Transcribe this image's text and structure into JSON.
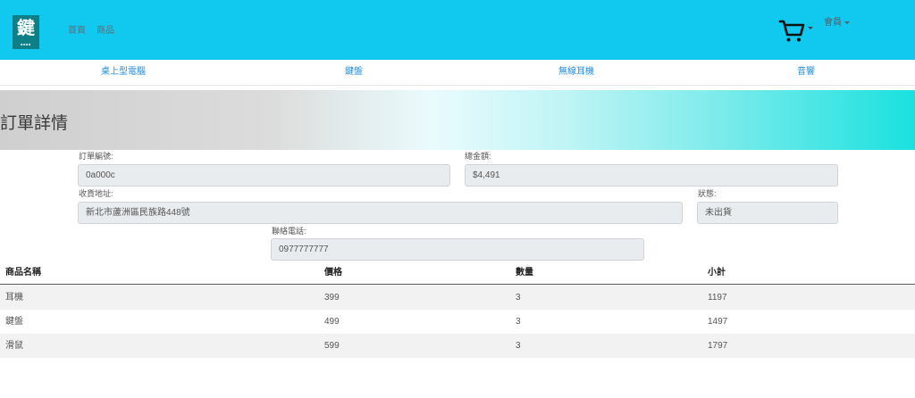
{
  "brand": {
    "logo_char": "鍵",
    "logo_sub": "■■■■"
  },
  "nav": {
    "home": "首頁",
    "products": "商品"
  },
  "member_menu": {
    "label": "會員"
  },
  "categories": [
    "桌上型電腦",
    "鍵盤",
    "無線耳機",
    "音響"
  ],
  "page": {
    "title": "訂單詳情"
  },
  "order": {
    "order_no_label": "訂單編號:",
    "order_no": "0a000c",
    "total_label": "總金額:",
    "total": "$4,491",
    "address_label": "收貨地址:",
    "address": "新北市蘆洲區民族路448號",
    "status_label": "狀態:",
    "status": "未出貨",
    "phone_label": "聯絡電話:",
    "phone": "0977777777"
  },
  "table": {
    "headers": [
      "商品名稱",
      "價格",
      "數量",
      "小計"
    ],
    "rows": [
      {
        "name": "耳機",
        "price": "399",
        "qty": "3",
        "subtotal": "1197"
      },
      {
        "name": "鍵盤",
        "price": "499",
        "qty": "3",
        "subtotal": "1497"
      },
      {
        "name": "滑鼠",
        "price": "599",
        "qty": "3",
        "subtotal": "1797"
      }
    ]
  },
  "colors": {
    "navbar": "#11c8ef",
    "logo_bg": "#0e7f86",
    "category_link": "#1f8de0",
    "field_bg": "#e9ecef"
  },
  "icons": {
    "cart": "shopping-cart-icon",
    "caret": "caret-down-icon"
  }
}
